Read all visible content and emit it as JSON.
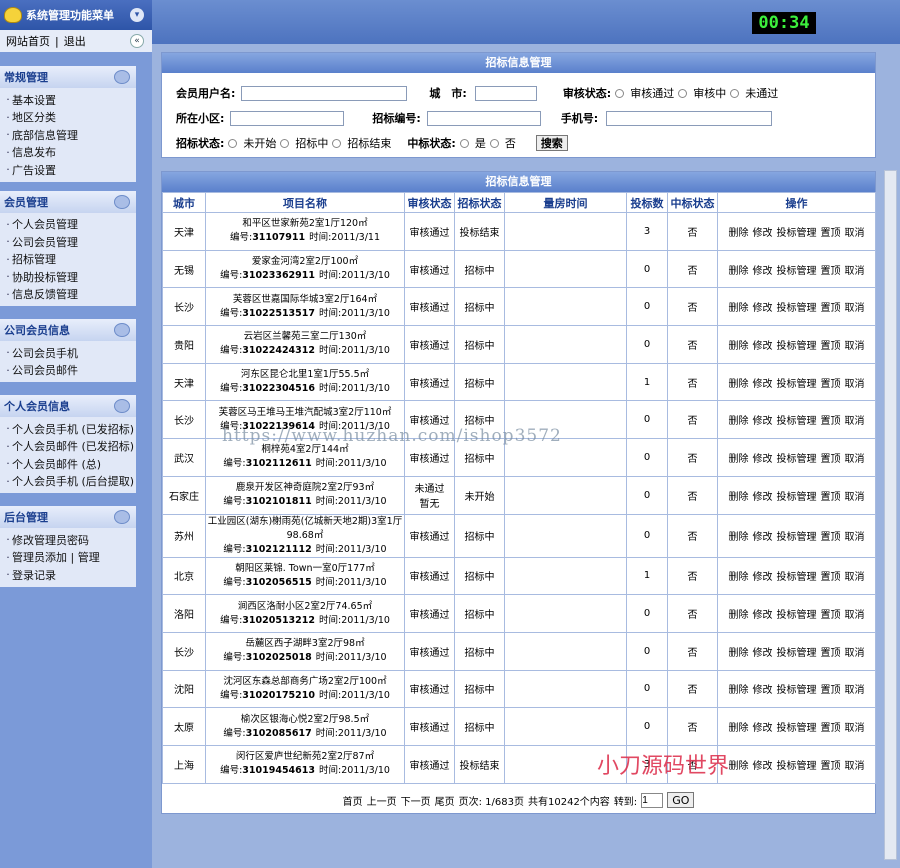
{
  "sidebar": {
    "title": "系统管理功能菜单",
    "home": "网站首页",
    "logout": "退出",
    "sections": [
      {
        "title": "常规管理",
        "items": [
          "基本设置",
          "地区分类",
          "底部信息管理",
          "信息发布",
          "广告设置"
        ]
      },
      {
        "title": "会员管理",
        "items": [
          "个人会员管理",
          "公司会员管理",
          "招标管理",
          "协助投标管理",
          "信息反馈管理"
        ]
      },
      {
        "title": "公司会员信息",
        "items": [
          "公司会员手机",
          "公司会员邮件"
        ]
      },
      {
        "title": "个人会员信息",
        "items": [
          "个人会员手机 (已发招标)",
          "个人会员邮件 (已发招标)",
          "个人会员邮件 (总)",
          "个人会员手机 (后台提取)"
        ]
      },
      {
        "title": "后台管理",
        "items": [
          "修改管理员密码",
          "管理员添加 | 管理",
          "登录记录"
        ]
      }
    ]
  },
  "clock": "00:34",
  "search": {
    "title": "招标信息管理",
    "member_label": "会员用户名:",
    "city_label": "城　市:",
    "audit_label": "审核状态:",
    "audit_options": [
      "审核通过",
      "审核中",
      "未通过"
    ],
    "community_label": "所在小区:",
    "bid_no_label": "招标编号:",
    "phone_label": "手机号:",
    "bid_status_label": "招标状态:",
    "bid_status_options": [
      "未开始",
      "招标中",
      "招标结束"
    ],
    "win_label": "中标状态:",
    "win_options": [
      "是",
      "否"
    ],
    "search_button": "搜索"
  },
  "list": {
    "title": "招标信息管理",
    "headers": [
      "城市",
      "项目名称",
      "审核状态",
      "招标状态",
      "量房时间",
      "投标数",
      "中标状态",
      "操作"
    ],
    "ops": [
      "删除",
      "修改",
      "投标管理",
      "置顶",
      "取消"
    ],
    "rows": [
      {
        "city": "天津",
        "name": "和平区世家新苑2室1厅120㎡",
        "code": "31107911",
        "time": "时间:2011/3/11",
        "audit": "审核通过",
        "status": "投标结束",
        "bids": "3",
        "win": "否"
      },
      {
        "city": "无锡",
        "name": "爱家金河湾2室2厅100㎡",
        "code": "31023362911",
        "time": "时间:2011/3/10",
        "audit": "审核通过",
        "status": "招标中",
        "bids": "0",
        "win": "否"
      },
      {
        "city": "长沙",
        "name": "芙蓉区世嘉国际华城3室2厅164㎡",
        "code": "31022513517",
        "time": "时间:2011/3/10",
        "audit": "审核通过",
        "status": "招标中",
        "bids": "0",
        "win": "否"
      },
      {
        "city": "贵阳",
        "name": "云岩区兰馨苑三室二厅130㎡",
        "code": "31022424312",
        "time": "时间:2011/3/10",
        "audit": "审核通过",
        "status": "招标中",
        "bids": "0",
        "win": "否"
      },
      {
        "city": "天津",
        "name": "河东区昆仑北里1室1厅55.5㎡",
        "code": "31022304516",
        "time": "时间:2011/3/10",
        "audit": "审核通过",
        "status": "招标中",
        "bids": "1",
        "win": "否"
      },
      {
        "city": "长沙",
        "name": "芙蓉区马王堆马王堆汽配城3室2厅110㎡",
        "code": "31022139614",
        "time": "时间:2011/3/10",
        "audit": "审核通过",
        "status": "招标中",
        "bids": "0",
        "win": "否"
      },
      {
        "city": "武汉",
        "name": "桐梓苑4室2厅144㎡",
        "code": "3102112611",
        "time": "时间:2011/3/10",
        "audit": "审核通过",
        "status": "招标中",
        "bids": "0",
        "win": "否"
      },
      {
        "city": "石家庄",
        "name": "鹿泉开发区神奇庭院2室2厅93㎡",
        "code": "3102101811",
        "time": "时间:2011/3/10",
        "audit": "未通过\n暂无",
        "status": "未开始",
        "bids": "0",
        "win": "否"
      },
      {
        "city": "苏州",
        "name": "工业园区(湖东)榭雨苑(亿城新天地2期)3室1厅98.68㎡",
        "code": "3102121112",
        "time": "时间:2011/3/10",
        "audit": "审核通过",
        "status": "招标中",
        "bids": "0",
        "win": "否"
      },
      {
        "city": "北京",
        "name": "朝阳区莱锦. Town一室0厅177㎡",
        "code": "3102056515",
        "time": "时间:2011/3/10",
        "audit": "审核通过",
        "status": "招标中",
        "bids": "1",
        "win": "否"
      },
      {
        "city": "洛阳",
        "name": "涧西区洛耐小区2室2厅74.65㎡",
        "code": "31020513212",
        "time": "时间:2011/3/10",
        "audit": "审核通过",
        "status": "招标中",
        "bids": "0",
        "win": "否"
      },
      {
        "city": "长沙",
        "name": "岳麓区西子湖畔3室2厅98㎡",
        "code": "3102025018",
        "time": "时间:2011/3/10",
        "audit": "审核通过",
        "status": "招标中",
        "bids": "0",
        "win": "否"
      },
      {
        "city": "沈阳",
        "name": "沈河区东森总部商务广场2室2厅100㎡",
        "code": "31020175210",
        "time": "时间:2011/3/10",
        "audit": "审核通过",
        "status": "招标中",
        "bids": "0",
        "win": "否"
      },
      {
        "city": "太原",
        "name": "榆次区银海心悦2室2厅98.5㎡",
        "code": "3102085617",
        "time": "时间:2011/3/10",
        "audit": "审核通过",
        "status": "招标中",
        "bids": "0",
        "win": "否"
      },
      {
        "city": "上海",
        "name": "闵行区爱庐世纪新苑2室2厅87㎡",
        "code": "31019454613",
        "time": "时间:2011/3/10",
        "audit": "审核通过",
        "status": "投标结束",
        "bids": "3",
        "win": "否"
      }
    ],
    "code_prefix": "编号:"
  },
  "pager": {
    "first": "首页",
    "prev": "上一页",
    "next": "下一页",
    "last": "尾页",
    "pages": "页次: 1/683页",
    "total": "共有10242个内容",
    "goto": "转到:",
    "value": "1",
    "go": "GO"
  },
  "watermark": "https://www.huzhan.com/ishop3572",
  "watermark2": "小刀源码世界"
}
